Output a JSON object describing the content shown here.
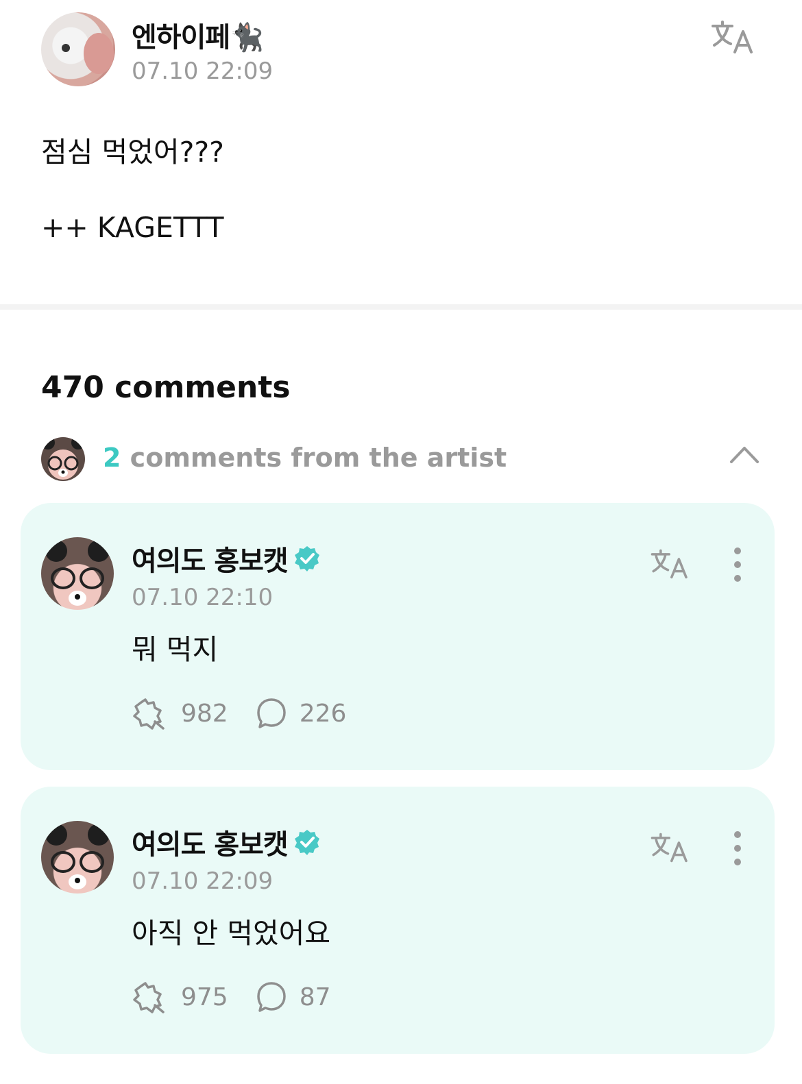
{
  "post": {
    "author": "엔하이페🐈‍⬛",
    "time": "07.10 22:09",
    "body_line1": "점심 먹었어???",
    "body_line2": "++ KAGETTT",
    "icons": {
      "translate": "translate-icon"
    }
  },
  "comments": {
    "count_label": "470 comments",
    "artist_summary": {
      "count": "2",
      "label": " comments from the artist",
      "expanded_icon": "chevron-up-icon"
    },
    "artist_comments": [
      {
        "name": "여의도 홍보캣",
        "time": "07.10 22:10",
        "text": "뭐 먹지",
        "likes": "982",
        "replies": "226"
      },
      {
        "name": "여의도 홍보캣",
        "time": "07.10 22:09",
        "text": "아직 안 먹었어요",
        "likes": "975",
        "replies": "87"
      }
    ]
  },
  "colors": {
    "accent": "#3cc9c2",
    "card_bg": "#eafaf7",
    "muted": "#9a9a9a"
  }
}
